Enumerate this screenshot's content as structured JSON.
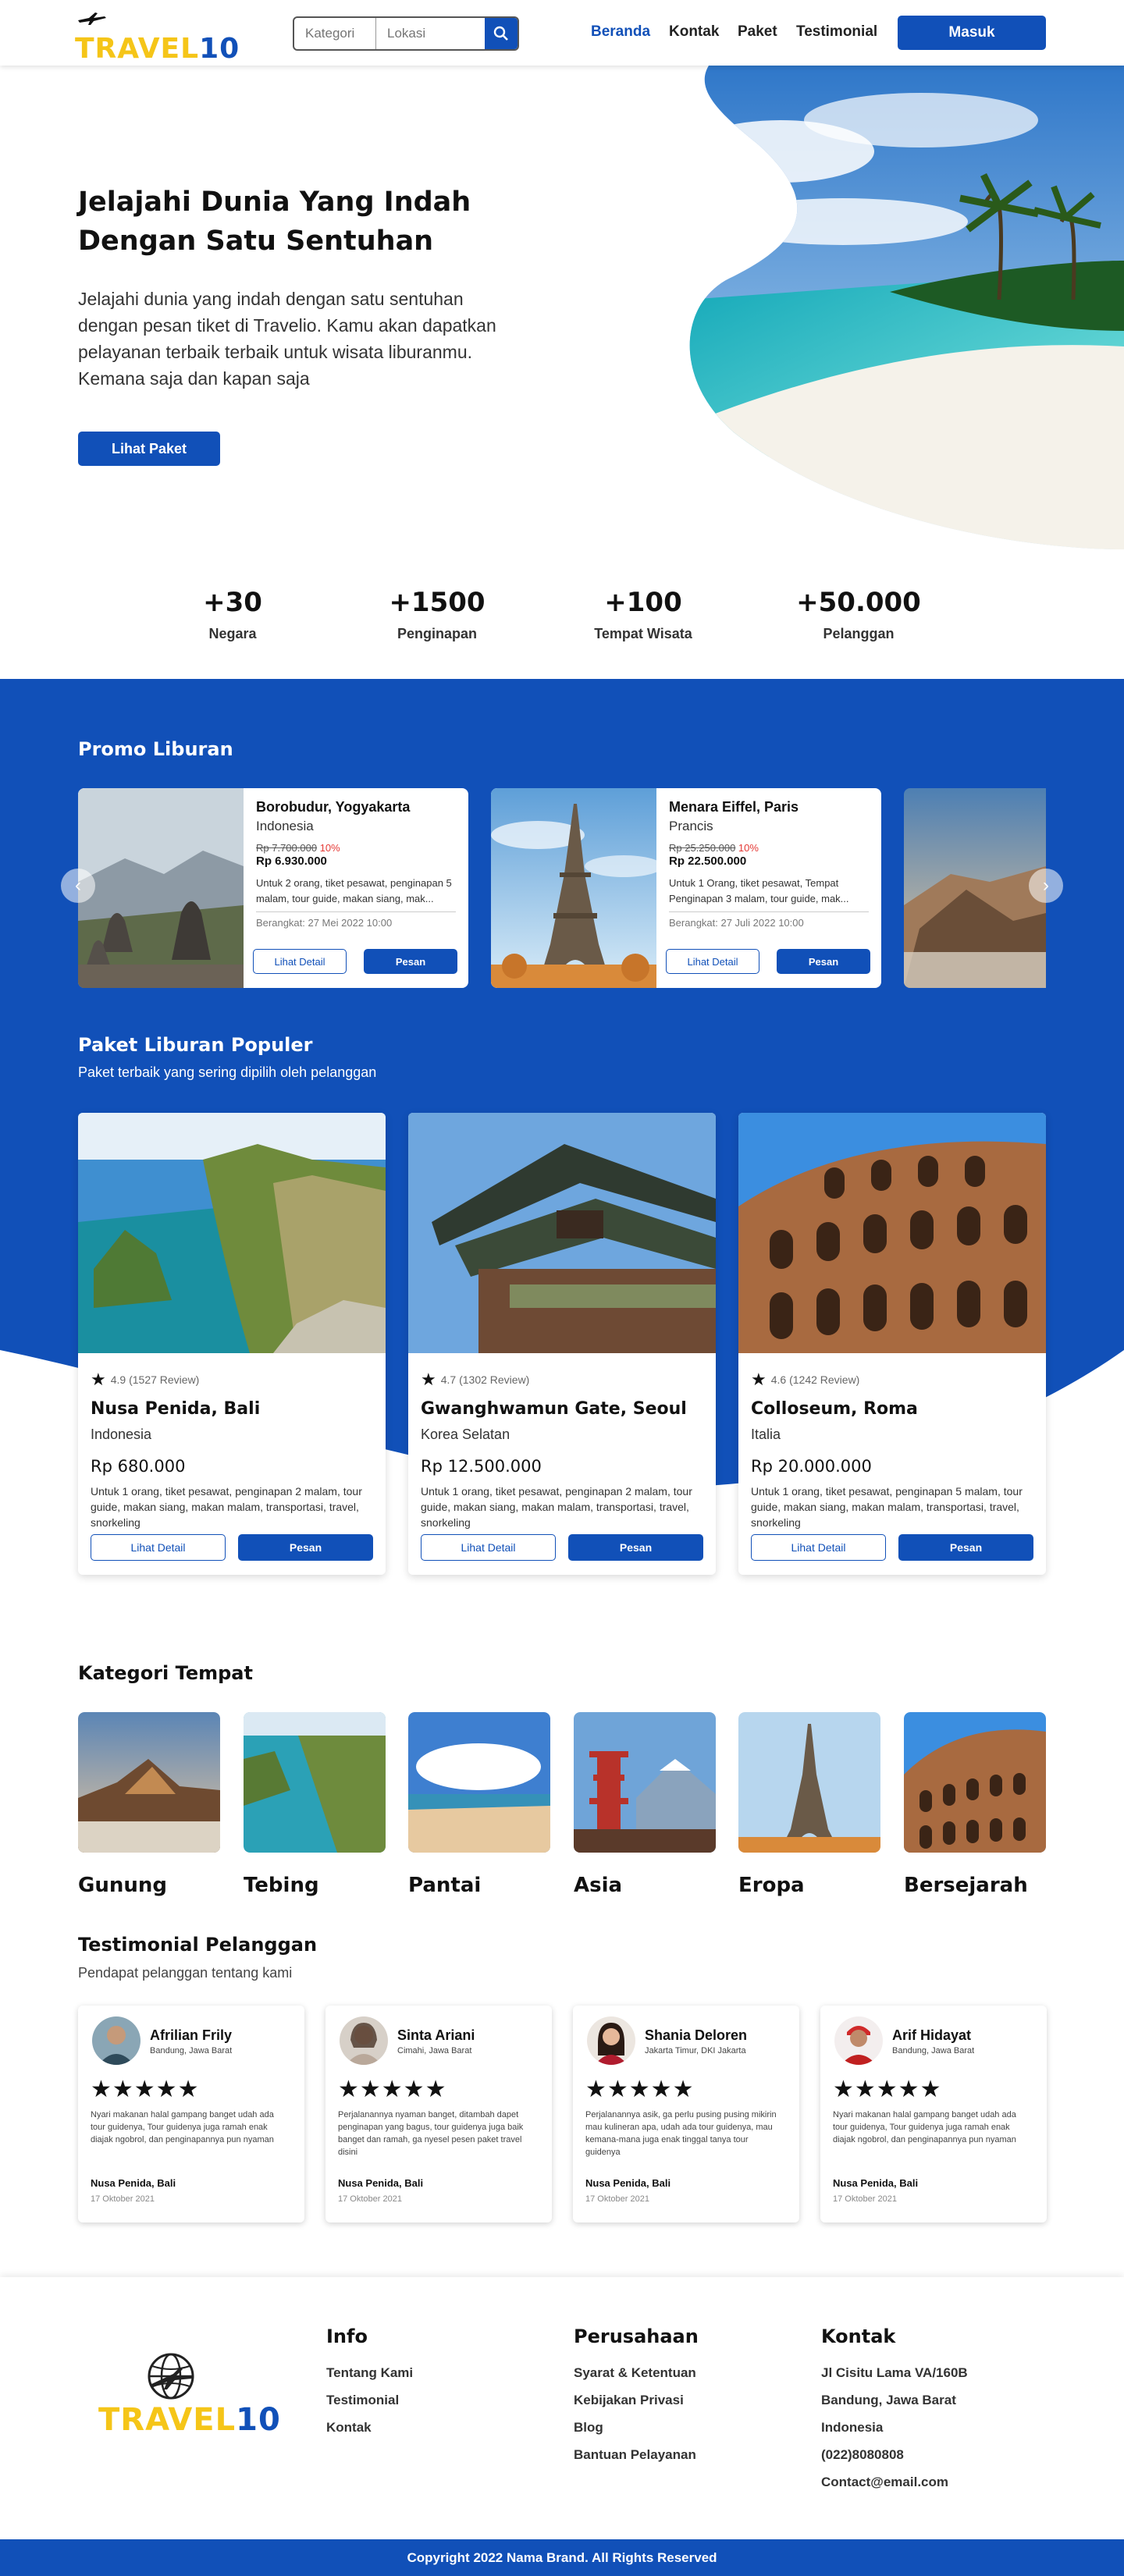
{
  "nav": {
    "logo_a": "TRAVEL",
    "logo_b": "10",
    "kategori_placeholder": "Kategori",
    "lokasi_placeholder": "Lokasi",
    "links": [
      "Beranda",
      "Kontak",
      "Paket",
      "Testimonial"
    ],
    "login": "Masuk"
  },
  "hero": {
    "title": "Jelajahi Dunia Yang Indah Dengan Satu Sentuhan",
    "text": "Jelajahi dunia yang indah dengan satu sentuhan dengan pesan tiket di Travelio. Kamu akan dapatkan pelayanan terbaik terbaik untuk wisata liburanmu. Kemana saja dan kapan saja",
    "cta": "Lihat Paket"
  },
  "stats": [
    {
      "value": "+30",
      "label": "Negara"
    },
    {
      "value": "+1500",
      "label": "Penginapan"
    },
    {
      "value": "+100",
      "label": "Tempat Wisata"
    },
    {
      "value": "+50.000",
      "label": "Pelanggan"
    }
  ],
  "promo": {
    "title": "Promo Liburan",
    "items": [
      {
        "name": "Borobudur, Yogyakarta",
        "country": "Indonesia",
        "old_price": "Rp 7.700.000",
        "discount": "10%",
        "price": "Rp 6.930.000",
        "desc": "Untuk 2 orang, tiket pesawat, penginapan 5 malam, tour guide, makan siang, mak...",
        "date": "Berangkat: 27 Mei 2022 10:00",
        "detail": "Lihat Detail",
        "order": "Pesan"
      },
      {
        "name": "Menara Eiffel, Paris",
        "country": "Prancis",
        "old_price": "Rp 25.250.000",
        "discount": "10%",
        "price": "Rp 22.500.000",
        "desc": "Untuk 1 Orang, tiket pesawat, Tempat Penginapan 3 malam, tour guide, mak...",
        "date": "Berangkat: 27 Juli 2022 10:00",
        "detail": "Lihat Detail",
        "order": "Pesan"
      }
    ]
  },
  "popular": {
    "title": "Paket Liburan Populer",
    "subtitle": "Paket terbaik yang sering dipilih oleh pelanggan",
    "items": [
      {
        "rating": "4.9 (1527 Review)",
        "name": "Nusa Penida, Bali",
        "country": "Indonesia",
        "price": "Rp 680.000",
        "desc": "Untuk 1 orang, tiket pesawat, penginapan 2 malam, tour guide, makan siang, makan malam, transportasi, travel, snorkeling",
        "detail": "Lihat Detail",
        "order": "Pesan"
      },
      {
        "rating": "4.7 (1302 Review)",
        "name": "Gwanghwamun Gate, Seoul",
        "country": "Korea Selatan",
        "price": "Rp 12.500.000",
        "desc": "Untuk 1 orang, tiket pesawat, penginapan 2 malam, tour guide, makan siang, makan malam, transportasi, travel, snorkeling",
        "detail": "Lihat Detail",
        "order": "Pesan"
      },
      {
        "rating": "4.6 (1242 Review)",
        "name": "Colloseum, Roma",
        "country": "Italia",
        "price": "Rp 20.000.000",
        "desc": "Untuk 1 orang, tiket pesawat, penginapan 5 malam, tour guide, makan siang, makan malam, transportasi, travel, snorkeling",
        "detail": "Lihat Detail",
        "order": "Pesan"
      }
    ]
  },
  "categories": {
    "title": "Kategori Tempat",
    "items": [
      "Gunung",
      "Tebing",
      "Pantai",
      "Asia",
      "Eropa",
      "Bersejarah"
    ]
  },
  "testimonials": {
    "title": "Testimonial Pelanggan",
    "subtitle": "Pendapat pelanggan tentang kami",
    "stars": "★★★★★",
    "items": [
      {
        "name": "Afrilian Frily",
        "location": "Bandung, Jawa Barat",
        "text": "Nyari makanan halal gampang banget udah ada tour guidenya, Tour guidenya juga ramah enak diajak ngobrol, dan penginapannya pun nyaman",
        "place": "Nusa Penida, Bali",
        "date": "17 Oktober 2021"
      },
      {
        "name": "Sinta Ariani",
        "location": "Cimahi, Jawa Barat",
        "text": "Perjalanannya nyaman banget, ditambah dapet penginapan yang bagus, tour guidenya juga baik banget dan ramah, ga nyesel pesen paket travel disini",
        "place": "Nusa Penida, Bali",
        "date": "17 Oktober 2021"
      },
      {
        "name": "Shania Deloren",
        "location": "Jakarta Timur, DKI Jakarta",
        "text": "Perjalanannya asik, ga perlu pusing pusing mikirin mau kulineran apa, udah ada tour guidenya, mau kemana-mana juga enak tinggal tanya tour guidenya",
        "place": "Nusa Penida, Bali",
        "date": "17 Oktober 2021"
      },
      {
        "name": "Arif Hidayat",
        "location": "Bandung, Jawa Barat",
        "text": "Nyari makanan halal gampang banget udah ada tour guidenya, Tour guidenya juga ramah enak diajak ngobrol, dan penginapannya pun nyaman",
        "place": "Nusa Penida, Bali",
        "date": "17 Oktober 2021"
      }
    ]
  },
  "footer": {
    "logo_a": "TRAVEL",
    "logo_b": "10",
    "info_title": "Info",
    "info_links": [
      "Tentang Kami",
      "Testimonial",
      "Kontak"
    ],
    "company_title": "Perusahaan",
    "company_links": [
      "Syarat & Ketentuan",
      "Kebijakan Privasi",
      "Blog",
      "Bantuan Pelayanan"
    ],
    "contact_title": "Kontak",
    "contact_lines": [
      "Jl Cisitu Lama VA/160B",
      "Bandung, Jawa Barat",
      "Indonesia",
      "(022)8080808",
      "Contact@email.com"
    ],
    "copyright": "Copyright 2022 Nama Brand. All Rights Reserved"
  },
  "colors": {
    "primary": "#1150b8",
    "accent": "#f5c518",
    "discount": "#e53935"
  }
}
